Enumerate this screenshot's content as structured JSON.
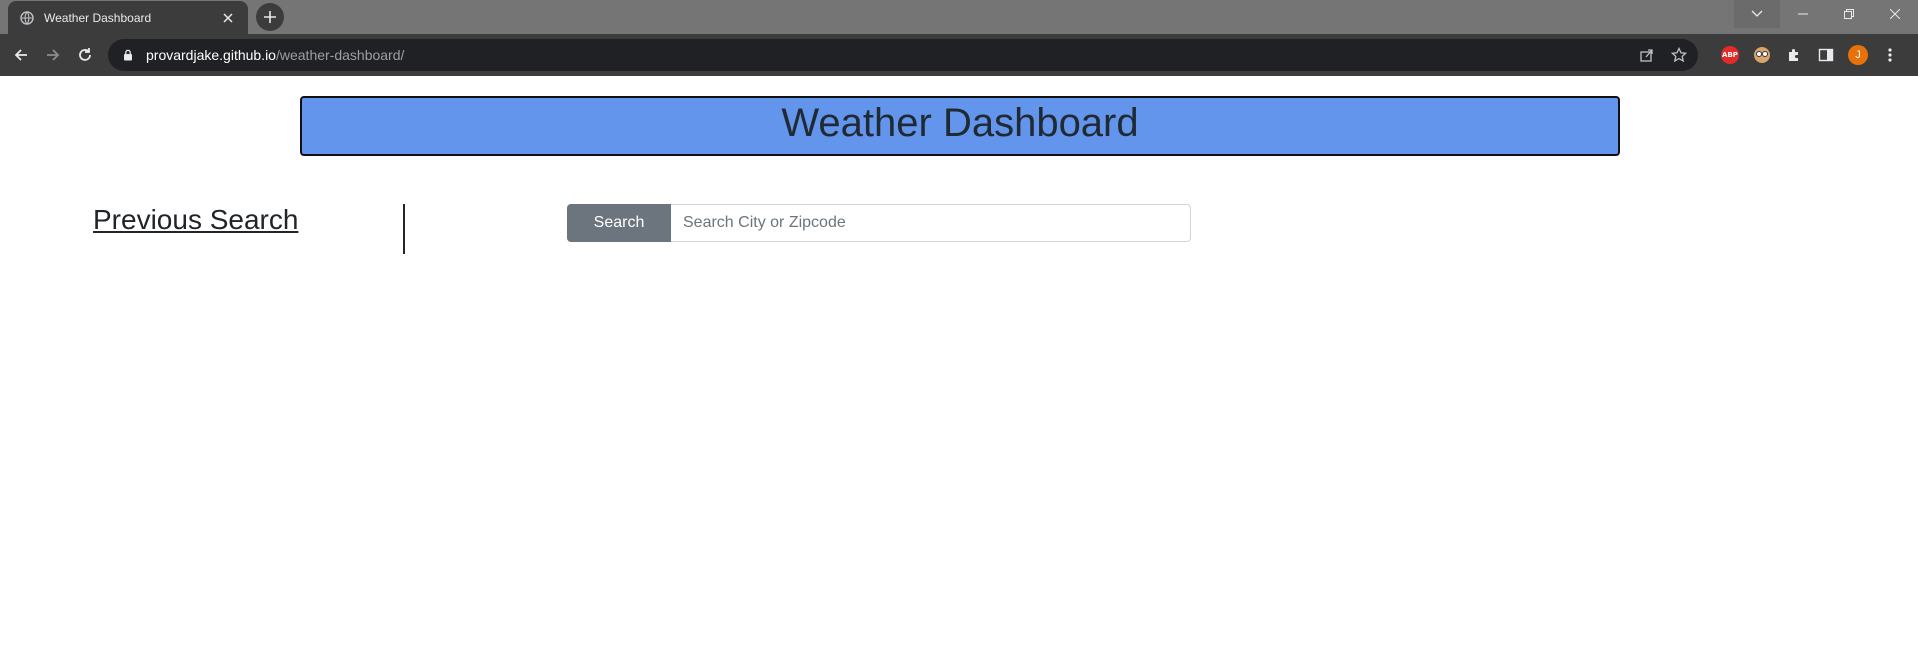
{
  "browser": {
    "tab": {
      "title": "Weather Dashboard",
      "favicon": "globe-icon",
      "close_icon": "close-icon"
    },
    "new_tab_icon": "plus-icon",
    "window_controls": [
      "tab-search-icon",
      "minimize-icon",
      "restore-icon",
      "close-window-icon"
    ],
    "nav": {
      "back_icon": "back-arrow-icon",
      "forward_icon": "forward-arrow-icon",
      "reload_icon": "reload-icon"
    },
    "address": {
      "lock_icon": "lock-icon",
      "host": "provardjake.github.io",
      "path": "/weather-dashboard/"
    },
    "omnibox_icons": [
      "share-icon",
      "bookmark-star-icon"
    ],
    "extensions": {
      "abp_label": "ABP",
      "avatar_letter": "J",
      "avatar_color": "#e8710a"
    }
  },
  "page": {
    "header": {
      "title": "Weather Dashboard",
      "background_color": "#6495ed"
    },
    "sidebar": {
      "heading": "Previous Search"
    },
    "search": {
      "button_label": "Search",
      "placeholder": "Search City or Zipcode",
      "value": "",
      "button_color": "#6c757d"
    }
  }
}
